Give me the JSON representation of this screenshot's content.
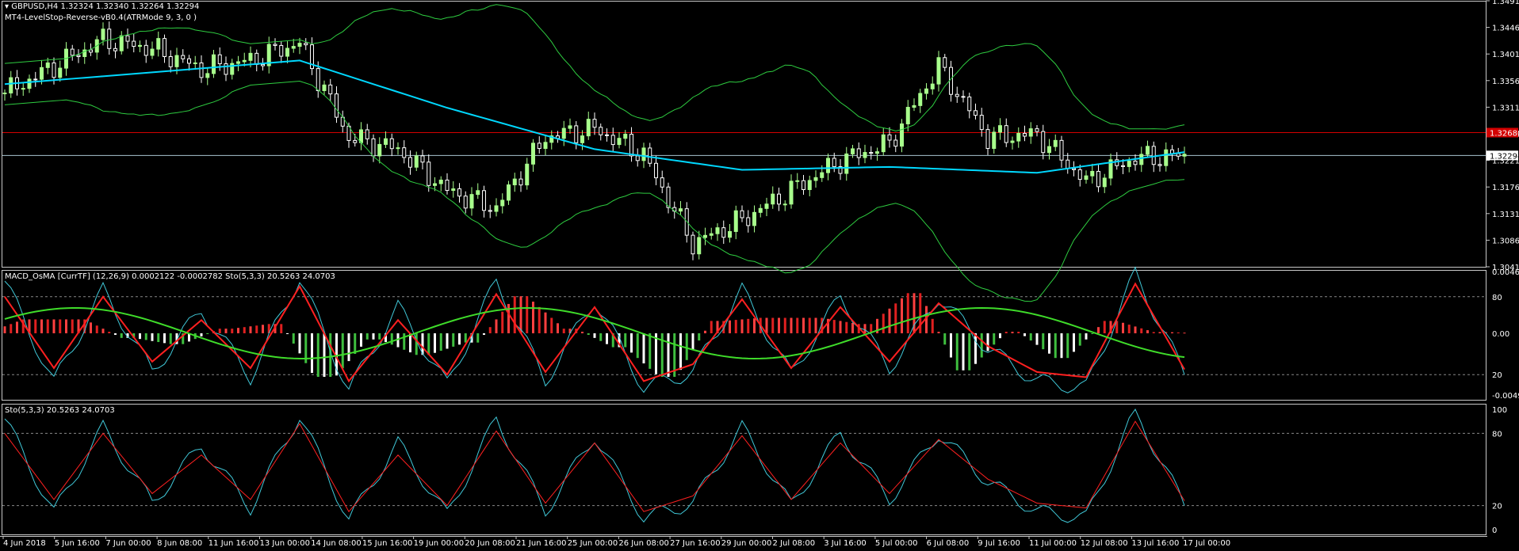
{
  "main": {
    "symbol_line": "GBPUSD,H4  1.32324 1.32340 1.32264 1.32294",
    "indicator_line": "MT4-LevelStop-Reverse-vB0.4(ATRMode 9, 3, 0 )",
    "price_ticks": [
      "1.34910",
      "1.34460",
      "1.34010",
      "1.33560",
      "1.33110",
      "1.32660",
      "1.32210",
      "1.31760",
      "1.31310",
      "1.30860",
      "1.30410"
    ],
    "current_price": "1.32294",
    "red_level": "1.32680",
    "colors": {
      "ma": "#00d8ff",
      "bb": "#2ecc40",
      "bull": "#a8ff8c",
      "bear": "#ffffff",
      "level": "#d40000"
    }
  },
  "macd": {
    "title": "MACD_OsMA [CurrTF] (12,26,9) 0.0002122 -0.0002782  Sto(5,3,3) 20.5263 24.0703",
    "ticks": [
      "0.004650",
      "80",
      "0.00",
      "20",
      "-0.004992"
    ]
  },
  "stoch": {
    "title": "Sto(5,3,3) 20.5263 24.0703",
    "ticks": [
      "100",
      "80",
      "20",
      "0"
    ]
  },
  "time_labels": [
    "4 Jun 2018",
    "5 Jun 16:00",
    "7 Jun 00:00",
    "8 Jun 08:00",
    "11 Jun 16:00",
    "13 Jun 00:00",
    "14 Jun 08:00",
    "15 Jun 16:00",
    "19 Jun 00:00",
    "20 Jun 08:00",
    "21 Jun 16:00",
    "25 Jun 00:00",
    "26 Jun 08:00",
    "27 Jun 16:00",
    "29 Jun 00:00",
    "2 Jul 08:00",
    "3 Jul 16:00",
    "5 Jul 00:00",
    "6 Jul 08:00",
    "9 Jul 16:00",
    "11 Jul 00:00",
    "12 Jul 08:00",
    "13 Jul 16:00",
    "17 Jul 00:00"
  ],
  "chart_data": {
    "type": "line",
    "series": [
      {
        "name": "Close (approx.)",
        "x": [
          0,
          8,
          16,
          24,
          32,
          40,
          48,
          56,
          64,
          72,
          80,
          88,
          96,
          104,
          112,
          120,
          128,
          136,
          144,
          152,
          160,
          168,
          176,
          184,
          192
        ],
        "values": [
          1.3335,
          1.338,
          1.3425,
          1.341,
          1.3375,
          1.339,
          1.342,
          1.326,
          1.324,
          1.317,
          1.314,
          1.326,
          1.3275,
          1.323,
          1.308,
          1.312,
          1.317,
          1.322,
          1.325,
          1.338,
          1.326,
          1.3265,
          1.3185,
          1.3225,
          1.3229
        ]
      },
      {
        "name": "MA (approx.)",
        "x": [
          0,
          24,
          48,
          72,
          96,
          120,
          144,
          168,
          192
        ],
        "values": [
          1.335,
          1.337,
          1.339,
          1.331,
          1.324,
          1.3205,
          1.321,
          1.32,
          1.3235
        ]
      },
      {
        "name": "Stoch %K",
        "x": [
          0,
          8,
          16,
          24,
          32,
          40,
          48,
          56,
          64,
          72,
          80,
          88,
          96,
          104,
          112,
          120,
          128,
          136,
          144,
          152,
          160,
          168,
          176,
          184,
          192
        ],
        "values": [
          92,
          14,
          85,
          22,
          70,
          18,
          95,
          8,
          72,
          12,
          92,
          15,
          78,
          10,
          22,
          85,
          20,
          80,
          25,
          80,
          40,
          15,
          10,
          98,
          20
        ]
      },
      {
        "name": "Stoch %D",
        "x": [
          0,
          8,
          16,
          24,
          32,
          40,
          48,
          56,
          64,
          72,
          80,
          88,
          96,
          104,
          112,
          120,
          128,
          136,
          144,
          152,
          160,
          168,
          176,
          184,
          192
        ],
        "values": [
          80,
          25,
          80,
          30,
          62,
          25,
          88,
          15,
          62,
          20,
          82,
          22,
          72,
          15,
          28,
          78,
          25,
          72,
          30,
          75,
          42,
          22,
          18,
          90,
          24
        ]
      }
    ],
    "ylim_price": [
      1.3041,
      1.3491
    ],
    "ylim_stoch": [
      0,
      100
    ]
  }
}
